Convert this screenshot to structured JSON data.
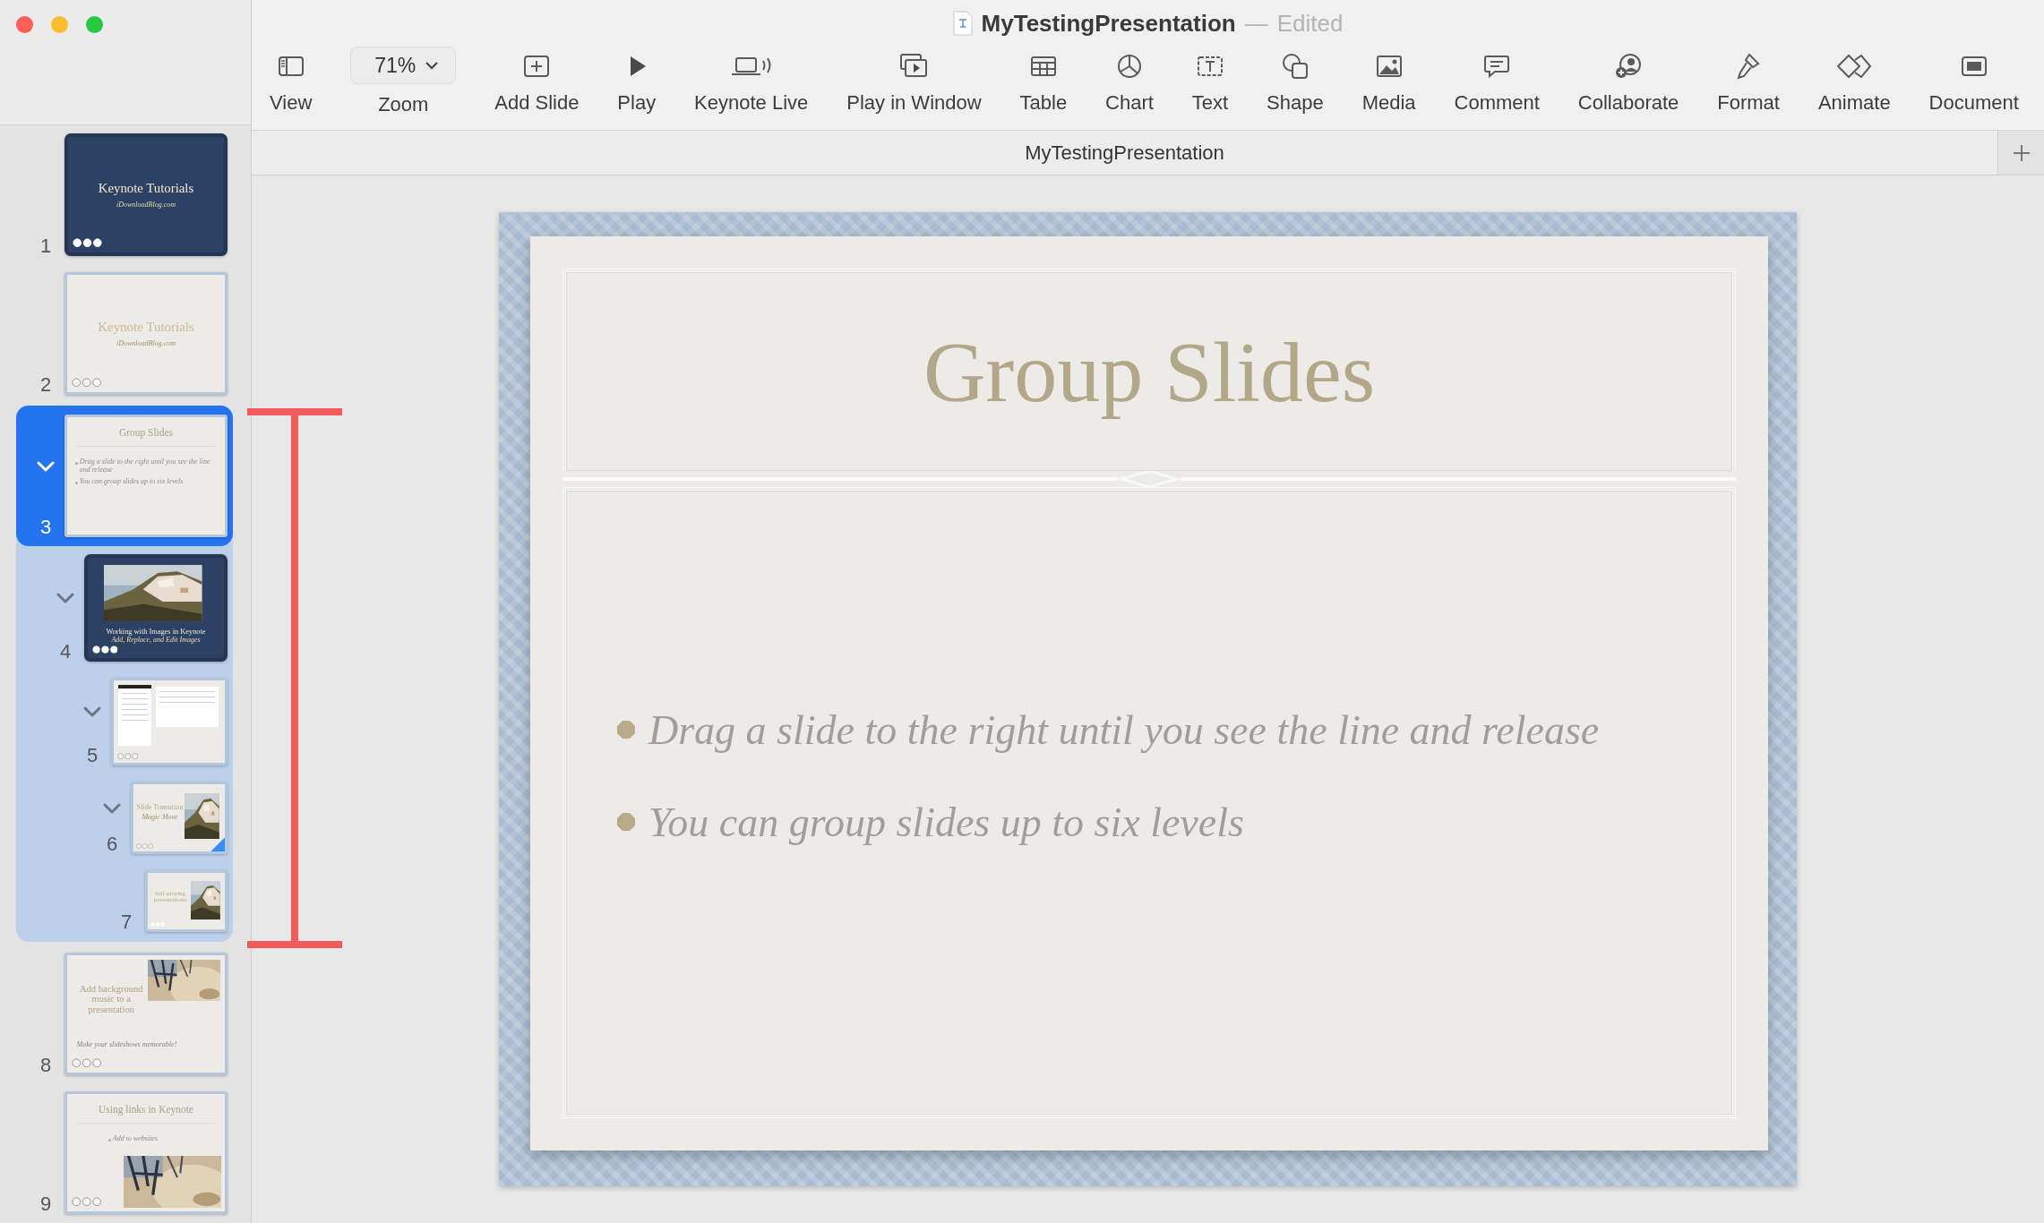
{
  "window": {
    "title": "MyTestingPresentation",
    "separator": "—",
    "status": "Edited"
  },
  "toolbar": [
    {
      "kind": "view",
      "label": "View"
    },
    {
      "kind": "zoom",
      "value": "71%",
      "label": "Zoom"
    },
    {
      "kind": "add-slide",
      "label": "Add Slide"
    },
    {
      "kind": "play",
      "label": "Play"
    },
    {
      "kind": "keynote-live",
      "label": "Keynote Live"
    },
    {
      "kind": "play-window",
      "label": "Play in Window"
    },
    {
      "kind": "table",
      "label": "Table"
    },
    {
      "kind": "chart",
      "label": "Chart"
    },
    {
      "kind": "text",
      "label": "Text"
    },
    {
      "kind": "shape",
      "label": "Shape"
    },
    {
      "kind": "media",
      "label": "Media"
    },
    {
      "kind": "comment",
      "label": "Comment"
    },
    {
      "kind": "collaborate",
      "label": "Collaborate"
    },
    {
      "kind": "format",
      "label": "Format"
    },
    {
      "kind": "animate",
      "label": "Animate"
    },
    {
      "kind": "document",
      "label": "Document"
    }
  ],
  "tab": {
    "title": "MyTestingPresentation"
  },
  "slides": [
    {
      "number": "1",
      "dark": true,
      "kind": "title",
      "title": "Keynote Tutorials",
      "subtitle": "iDownloadBlog.com",
      "dots_filled": true,
      "selected": false,
      "transition": false
    },
    {
      "number": "2",
      "dark": false,
      "kind": "title",
      "title": "Keynote Tutorials",
      "subtitle": "iDownloadBlog.com",
      "dots_filled": false,
      "selected": false,
      "transition": false
    },
    {
      "number": "3",
      "dark": false,
      "kind": "bullets",
      "title": "Group Slides",
      "bullets": [
        "Drag a slide to the right until you see the line and release",
        "You can group slides up to six levels"
      ],
      "selected": true,
      "transition": false,
      "expanded": true,
      "children": [
        {
          "number": "4",
          "dark": true,
          "kind": "photo-top",
          "title": "Working with Images in Keynote",
          "subtitle": "Add, Replace, and Edit Images",
          "dots_filled": true,
          "selected": false,
          "transition": false,
          "expanded": true,
          "children": [
            {
              "number": "5",
              "dark": false,
              "kind": "screenshot",
              "dots_filled": false,
              "selected": false,
              "transition": false,
              "expanded": true,
              "children": [
                {
                  "number": "6",
                  "dark": false,
                  "kind": "photo-right",
                  "title": "Slide Transition",
                  "subtitle": "Magic Move",
                  "dots_filled": false,
                  "selected": false,
                  "transition": true,
                  "expanded": true,
                  "children": [
                    {
                      "number": "7",
                      "dark": false,
                      "kind": "photo-right",
                      "title": "Self-playing presentations",
                      "dots_filled": true,
                      "selected": false,
                      "transition": false
                    }
                  ]
                }
              ]
            }
          ]
        }
      ]
    },
    {
      "number": "8",
      "dark": false,
      "kind": "photo-corner",
      "title": "Add background music to a presentation",
      "subtitle": "Make your slideshows memorable!",
      "dots_filled": false,
      "selected": false,
      "transition": false
    },
    {
      "number": "9",
      "dark": false,
      "kind": "bullets-photo",
      "title": "Using links in Keynote",
      "bullets": [
        "Add to websites"
      ],
      "dots_filled": false,
      "selected": false,
      "transition": false
    }
  ],
  "slide": {
    "title": "Group Slides",
    "bullets": [
      "Drag a slide to the right until you see the line and release",
      "You can group slides up to six levels"
    ]
  }
}
